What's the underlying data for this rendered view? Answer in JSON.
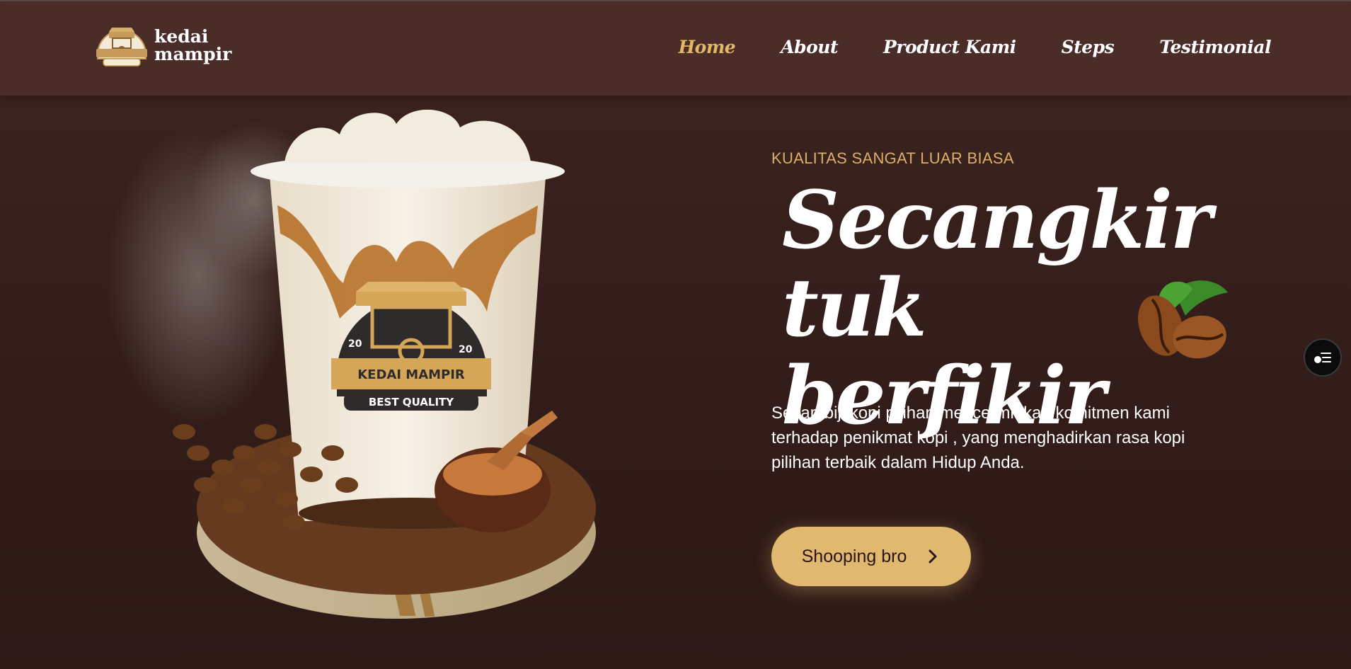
{
  "brand": {
    "line1": "kedai",
    "line2": "mampir"
  },
  "nav": {
    "items": [
      "Home",
      "About",
      "Product Kami",
      "Steps",
      "Testimonial"
    ],
    "active": "Home"
  },
  "hero": {
    "kicker": "KUALITAS SANGAT LUAR BIASA",
    "title_line1": "Secangkir tuk",
    "title_line2": "berfikir",
    "description": "Setiap biji kopi pilihan mencerminkan komitmen kami terhadap penikmat kopi , yang menghadirkan rasa kopi pilihan terbaik dalam Hidup Anda.",
    "cta_label": "Shooping bro",
    "cup_badge": {
      "year_left": "20",
      "year_right": "20",
      "name": "KEDAI MAMPIR",
      "tagline": "BEST QUALITY"
    }
  },
  "colors": {
    "accent": "#e2b867",
    "header_bg": "#4a2c28",
    "page_bg": "#331d1a",
    "button": "#e1b86f"
  },
  "icons": [
    "logo-badge-icon",
    "chevron-right-icon",
    "accessibility-menu-icon",
    "coffee-beans-icon"
  ]
}
